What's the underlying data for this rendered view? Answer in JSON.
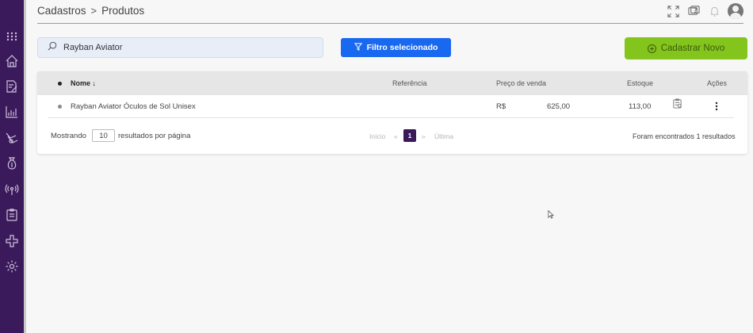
{
  "breadcrumb": {
    "section": "Cadastros",
    "separator": ">",
    "page": "Produtos"
  },
  "search": {
    "value": "Rayban Aviator"
  },
  "buttons": {
    "filter": "Filtro selecionado",
    "new": "Cadastrar Novo"
  },
  "table": {
    "columns": [
      "Nome ↓",
      "Referência",
      "Preço de venda",
      "Estoque",
      "Ações"
    ],
    "rows": [
      {
        "name": "Rayban Aviator Óculos de Sol Unisex",
        "reference": "",
        "currency": "R$",
        "price": "625,00",
        "stock": "113,00"
      }
    ]
  },
  "pagination": {
    "showing": "Mostrando",
    "page_size": "10",
    "per_page": "resultados por página",
    "first": "Início",
    "prev": "«",
    "current": "1",
    "next": "»",
    "last": "Última",
    "results": "Foram encontrados 1 resultados"
  },
  "colors": {
    "sidebar": "#3a1a5a",
    "primary": "#1968f0",
    "accent": "#84c51d"
  },
  "icons": {
    "sidebar": [
      "apps-grid-icon",
      "home-icon",
      "document-edit-icon",
      "chart-icon",
      "truck-icon",
      "money-bag-icon",
      "antenna-icon",
      "clipboard-icon",
      "integrations-icon",
      "settings-icon"
    ],
    "top": [
      "fullscreen-icon",
      "help-icon",
      "bell-icon",
      "user-icon"
    ]
  }
}
